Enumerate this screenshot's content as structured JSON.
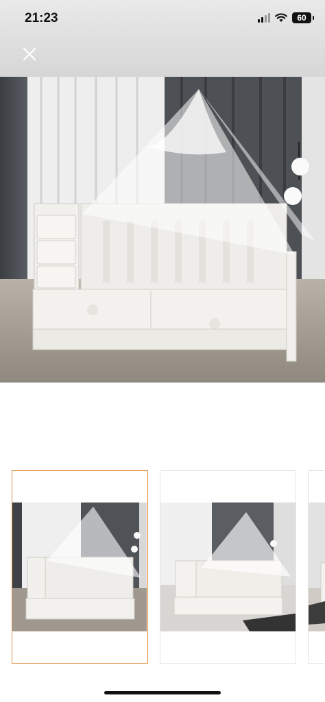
{
  "status_bar": {
    "time": "21:23",
    "battery": "60",
    "icons": [
      "signal-icon",
      "wifi-icon",
      "battery-icon"
    ]
  },
  "toolbar": {
    "close_icon": "close-icon"
  },
  "gallery": {
    "main_image": "baby-crib-with-canopy-photo",
    "selected_index": 0,
    "thumbnails": [
      {
        "image": "baby-crib-with-canopy-photo",
        "selected": true
      },
      {
        "image": "baby-crib-with-canopy-rug-photo",
        "selected": false
      },
      {
        "image": "baby-crib-partial-photo",
        "selected": false
      }
    ],
    "accent_color": "#e08a3c"
  }
}
